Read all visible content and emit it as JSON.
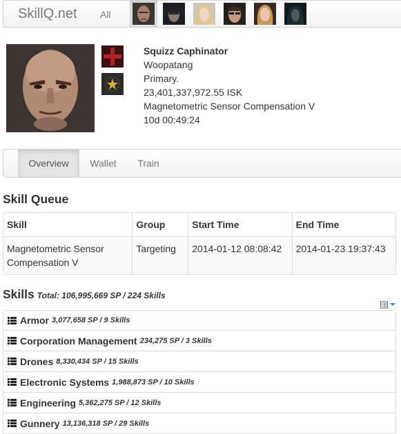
{
  "nav": {
    "brand": "SkillQ.net",
    "all_label": "All",
    "characters": [
      {
        "icon": "portrait-bald-man"
      },
      {
        "icon": "portrait-dark-hair-man"
      },
      {
        "icon": "portrait-blonde-woman"
      },
      {
        "icon": "portrait-man-dark-glasses"
      },
      {
        "icon": "portrait-blonde-woman-2"
      },
      {
        "icon": "portrait-dark-figure"
      }
    ]
  },
  "character": {
    "name": "Squizz Caphinator",
    "corporation": "Woopatang",
    "clone": "Primary.",
    "balance": "23,401,337,972.55 ISK",
    "training_skill": "Magnetometric Sensor Compensation V",
    "time_left": "10d 00:49:24"
  },
  "tabs": [
    {
      "label": "Overview",
      "active": true
    },
    {
      "label": "Wallet",
      "active": false
    },
    {
      "label": "Train",
      "active": false
    }
  ],
  "queue": {
    "title": "Skill Queue",
    "headers": [
      "Skill",
      "Group",
      "Start Time",
      "End Time"
    ],
    "rows": [
      [
        "Magnetometric Sensor Compensation V",
        "Targeting",
        "2014-01-12 08:08:42",
        "2014-01-23 19:37:43"
      ]
    ]
  },
  "skills": {
    "title": "Skills",
    "summary": "Total: 106,995,669 SP / 224 Skills",
    "options_icon": "list-options-icon",
    "groups": [
      {
        "name": "Armor",
        "stats": "3,077,658 SP / 9 Skills"
      },
      {
        "name": "Corporation Management",
        "stats": "234,275 SP / 3 Skills"
      },
      {
        "name": "Drones",
        "stats": "8,330,434 SP / 15 Skills"
      },
      {
        "name": "Electronic Systems",
        "stats": "1,988,873 SP / 10 Skills"
      },
      {
        "name": "Engineering",
        "stats": "5,362,275 SP / 12 Skills"
      },
      {
        "name": "Gunnery",
        "stats": "13,136,318 SP / 29 Skills"
      }
    ]
  },
  "colors": {
    "accent": "#3a87d6",
    "corp_logo_bg": "#3a1010",
    "corp_logo_cross": "#b22222"
  }
}
